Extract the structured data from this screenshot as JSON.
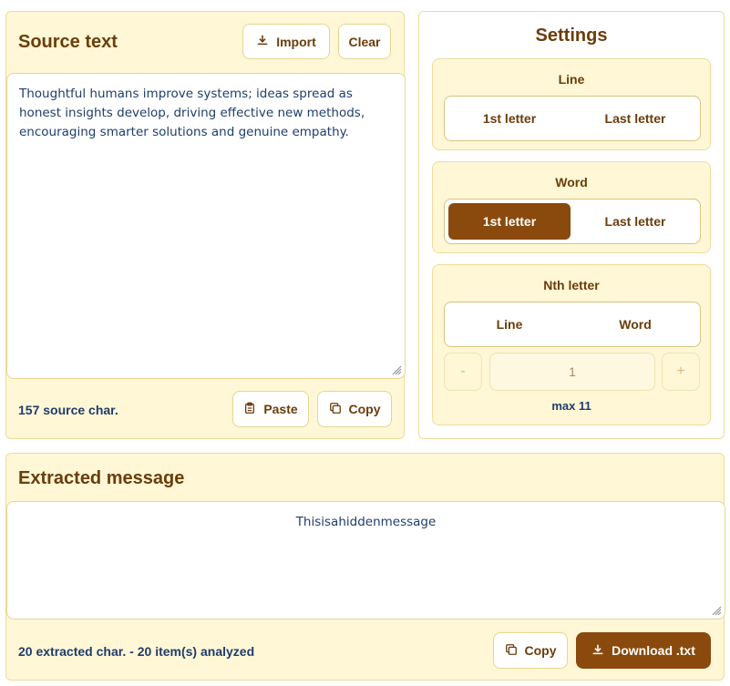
{
  "source": {
    "title": "Source text",
    "import_label": "Import",
    "clear_label": "Clear",
    "text": "Thoughtful humans improve systems; ideas spread as honest insights develop, driving effective new methods, encouraging smarter solutions and genuine empathy.",
    "count_label": "157 source char.",
    "paste_label": "Paste",
    "copy_label": "Copy"
  },
  "settings": {
    "title": "Settings",
    "line": {
      "label": "Line",
      "options": [
        "1st letter",
        "Last letter"
      ],
      "selected": null
    },
    "word": {
      "label": "Word",
      "options": [
        "1st letter",
        "Last letter"
      ],
      "selected": "1st letter"
    },
    "nth": {
      "label": "Nth letter",
      "options": [
        "Line",
        "Word"
      ],
      "selected": null,
      "minus": "-",
      "plus": "+",
      "value": "1",
      "max_label": "max 11"
    }
  },
  "extracted": {
    "title": "Extracted message",
    "text": "Thisisahiddenmessage",
    "count_label": "20 extracted char. - 20 item(s) analyzed",
    "copy_label": "Copy",
    "download_label": "Download .txt"
  },
  "colors": {
    "accent": "#8a4a0d",
    "panel_bg": "#fff7d6",
    "border": "#efdc9a",
    "text_blue": "#1f3d6b",
    "text_brown": "#6b3d0a"
  }
}
